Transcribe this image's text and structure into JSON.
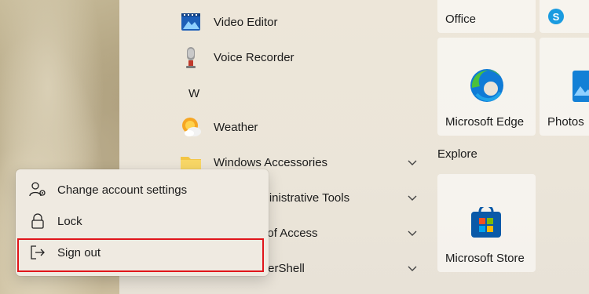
{
  "app_list": {
    "items": [
      {
        "label": "Video Editor",
        "icon": "video-editor-icon"
      },
      {
        "label": "Voice Recorder",
        "icon": "microphone-icon"
      },
      {
        "label": "Weather",
        "icon": "weather-icon"
      },
      {
        "label": "Windows Accessories",
        "icon": "folder-icon"
      },
      {
        "label": "Administrative Tools",
        "icon": "folder-icon"
      },
      {
        "label": "ase of Access",
        "icon": "folder-icon"
      },
      {
        "label": "PowerShell",
        "icon": "folder-icon"
      }
    ],
    "letter_header": "W"
  },
  "pinned": {
    "tiles": [
      {
        "label": "Office",
        "icon": "office-icon"
      },
      {
        "label": "Microsoft Edge",
        "icon": "edge-icon"
      },
      {
        "label": "Photos",
        "icon": "photos-icon"
      },
      {
        "label": "Microsoft Store",
        "icon": "store-icon"
      }
    ],
    "section_label": "Explore"
  },
  "account_menu": {
    "items": [
      {
        "label": "Change account settings",
        "icon": "person-settings-icon"
      },
      {
        "label": "Lock",
        "icon": "lock-icon"
      },
      {
        "label": "Sign out",
        "icon": "sign-out-icon"
      }
    ]
  },
  "colors": {
    "highlight": "#e0151b",
    "edge_blue": "#0f7bd6",
    "edge_green": "#4bc13b",
    "store_blue": "#0a5aa8"
  }
}
